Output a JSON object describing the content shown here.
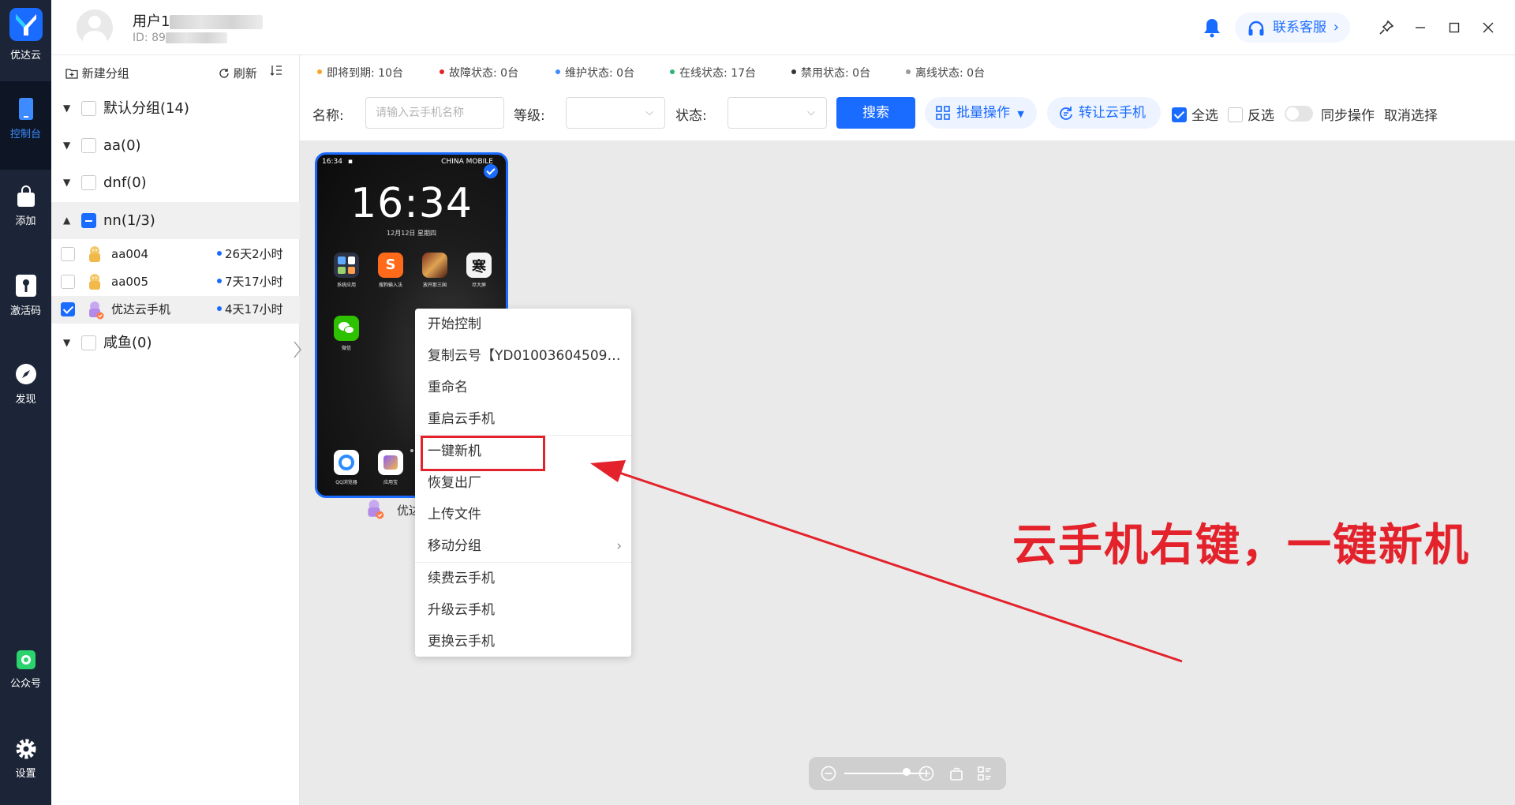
{
  "app": {
    "name": "优达云",
    "nav": [
      {
        "label": "控制台",
        "icon": "phone-icon",
        "active": true
      },
      {
        "label": "添加",
        "icon": "bag-icon"
      },
      {
        "label": "激活码",
        "icon": "key-icon"
      },
      {
        "label": "发现",
        "icon": "compass-icon"
      },
      {
        "label": "公众号",
        "icon": "wechat-official-icon"
      },
      {
        "label": "设置",
        "icon": "gear-icon"
      }
    ]
  },
  "header": {
    "user_name": "用户1",
    "user_id_prefix": "ID: 89",
    "service_label": "联系客服"
  },
  "group_panel": {
    "new_group": "新建分组",
    "refresh": "刷新",
    "groups": [
      {
        "label": "默认分组(14)"
      },
      {
        "label": "aa(0)"
      },
      {
        "label": "dnf(0)"
      },
      {
        "label": "nn(1/3)"
      },
      {
        "label": "咸鱼(0)"
      }
    ],
    "devices": [
      {
        "name": "aa004",
        "time": "26天2小时"
      },
      {
        "name": "aa005",
        "time": "7天17小时"
      },
      {
        "name": "优达云手机",
        "time": "4天17小时"
      }
    ]
  },
  "status": [
    {
      "label": "即将到期: 10台",
      "color": "#f5a623"
    },
    {
      "label": "故障状态: 0台",
      "color": "#e3222b"
    },
    {
      "label": "维护状态: 0台",
      "color": "#3d8bff"
    },
    {
      "label": "在线状态: 17台",
      "color": "#2bb673"
    },
    {
      "label": "禁用状态: 0台",
      "color": "#333333"
    },
    {
      "label": "离线状态: 0台",
      "color": "#999999"
    }
  ],
  "filters": {
    "name_label": "名称:",
    "name_placeholder": "请输入云手机名称",
    "level_label": "等级:",
    "state_label": "状态:",
    "search": "搜索",
    "batch": "批量操作",
    "transfer": "转让云手机",
    "select_all": "全选",
    "invert": "反选",
    "sync": "同步操作",
    "cancel": "取消选择"
  },
  "phone": {
    "status_time": "16:34",
    "carrier": "CHINA MOBILE",
    "clock": "16:34",
    "date": "12月12日 星期四",
    "apps": [
      {
        "label": "系统应用"
      },
      {
        "label": "搜狗输入法"
      },
      {
        "label": "放开那三国"
      },
      {
        "label": "尽大屏"
      },
      {
        "label": "微信"
      },
      {
        "label": "QQ浏览器"
      },
      {
        "label": "应用宝"
      }
    ],
    "label": "优达"
  },
  "context_menu": {
    "items": [
      "开始控制",
      "复制云号【YD01003604509…",
      "重命名",
      "重启云手机",
      "一键新机",
      "恢复出厂",
      "上传文件",
      "移动分组",
      "续费云手机",
      "升级云手机",
      "更换云手机"
    ],
    "highlighted": "一键新机"
  },
  "annotation": "云手机右键，一键新机",
  "colors": {
    "accent": "#1a6bff",
    "annotation": "#e3222b",
    "rail": "#1c2537"
  }
}
